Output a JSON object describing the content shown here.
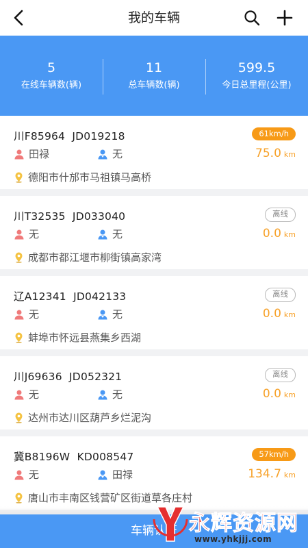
{
  "header": {
    "title": "我的车辆"
  },
  "summary": [
    {
      "value": "5",
      "label": "在线车辆数(辆)"
    },
    {
      "value": "11",
      "label": "总车辆数(辆)"
    },
    {
      "value": "599.5",
      "label": "今日总里程(公里)"
    }
  ],
  "vehicles": [
    {
      "plate": "川F85964  JD019218",
      "status": "61km/h",
      "status_type": "speed",
      "driver": "田禄",
      "escort": "无",
      "mileage": "75.0",
      "mileage_unit": "km",
      "location": "德阳市什邡市马祖镇马高桥"
    },
    {
      "plate": "川T32535  JD033040",
      "status": "离线",
      "status_type": "offline",
      "driver": "无",
      "escort": "无",
      "mileage": "0.0",
      "mileage_unit": "km",
      "location": "成都市都江堰市柳街镇高家湾"
    },
    {
      "plate": "辽A12341  JD042133",
      "status": "离线",
      "status_type": "offline",
      "driver": "无",
      "escort": "无",
      "mileage": "0.0",
      "mileage_unit": "km",
      "location": "蚌埠市怀远县燕集乡西湖"
    },
    {
      "plate": "川J69636  JD052321",
      "status": "离线",
      "status_type": "offline",
      "driver": "无",
      "escort": "无",
      "mileage": "0.0",
      "mileage_unit": "km",
      "location": "达州市达川区葫芦乡烂泥沟"
    },
    {
      "plate": "冀B8196W  KD008547",
      "status": "57km/h",
      "status_type": "speed",
      "driver": "无",
      "escort": "田禄",
      "mileage": "134.7",
      "mileage_unit": "km",
      "location": "唐山市丰南区钱营矿区街道草各庄村"
    }
  ],
  "footer": {
    "button_label": "车辆认证"
  },
  "watermark": {
    "text": "永辉资源网",
    "url": "www.yhkjjj.com"
  },
  "colors": {
    "primary": "#4a98f4",
    "accent": "#f79a17",
    "driver_icon": "#f07a7a",
    "escort_icon": "#4a98f4",
    "location_icon": "#f5c342"
  }
}
